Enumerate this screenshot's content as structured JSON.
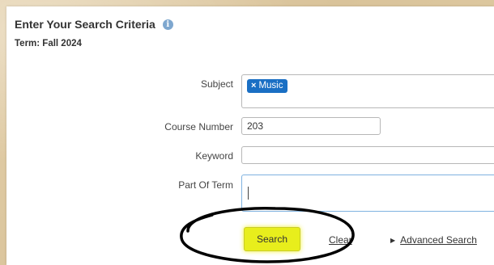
{
  "header": {
    "title": "Enter Your Search Criteria",
    "info_icon": "info-icon",
    "term": "Term: Fall 2024"
  },
  "form": {
    "subject_label": "Subject",
    "subject_tags": [
      "Music"
    ],
    "course_number_label": "Course Number",
    "course_number_value": "203",
    "keyword_label": "Keyword",
    "keyword_value": "",
    "part_of_term_label": "Part Of Term",
    "part_of_term_value": ""
  },
  "actions": {
    "search_label": "Search",
    "clear_label": "Clear",
    "advanced_label": "Advanced Search"
  },
  "colors": {
    "tag_bg": "#1a6fc4",
    "search_highlight": "#e8ee1c",
    "annotation_ring": "#000000"
  }
}
